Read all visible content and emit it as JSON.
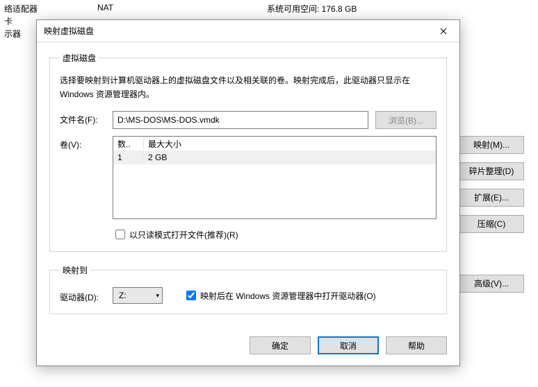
{
  "background": {
    "leftList": [
      "络适配器",
      "卡",
      "示器"
    ],
    "nat": "NAT",
    "availableSpace": "系统可用空间: 176.8 GB",
    "rightButtons": {
      "map": "映射(M)...",
      "defrag": "碎片整理(D)",
      "expand": "扩展(E)...",
      "compress": "压缩(C)"
    },
    "advanced": "高级(V)..."
  },
  "dialog": {
    "title": "映射虚拟磁盘",
    "group1": {
      "legend": "虚拟磁盘",
      "desc": "选择要映射到计算机驱动器上的虚拟磁盘文件以及相关联的卷。映射完成后，此驱动器只显示在 Windows 资源管理器内。",
      "filenameLabel": "文件名(F):",
      "filenameValue": "D:\\MS-DOS\\MS-DOS.vmdk",
      "browse": "浏览(B)...",
      "volumeLabel": "卷(V):",
      "volHeader1": "数..",
      "volHeader2": "最大大小",
      "volRow1Col1": "1",
      "volRow1Col2": "2 GB",
      "readonlyLabel": "以只读模式打开文件(推荐)(R)"
    },
    "group2": {
      "legend": "映射到",
      "driveLabel": "驱动器(D):",
      "driveValue": "Z:",
      "openAfterLabel": "映射后在 Windows 资源管理器中打开驱动器(O)"
    },
    "buttons": {
      "ok": "确定",
      "cancel": "取消",
      "help": "帮助"
    }
  }
}
